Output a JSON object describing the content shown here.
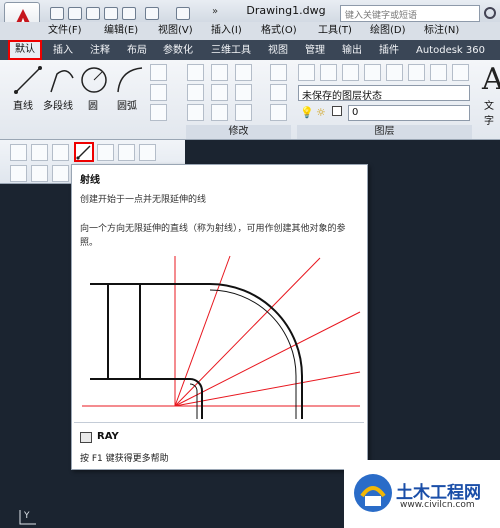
{
  "title_bar": {
    "document_title": "Drawing1.dwg",
    "search_placeholder": "键入关键字或短语",
    "qa_more": "»"
  },
  "menu": [
    "文件(F)",
    "编辑(E)",
    "视图(V)",
    "插入(I)",
    "格式(O)",
    "工具(T)",
    "绘图(D)",
    "标注(N)"
  ],
  "tabs": [
    "默认",
    "插入",
    "注释",
    "布局",
    "参数化",
    "三维工具",
    "视图",
    "管理",
    "输出",
    "插件",
    "Autodesk 360"
  ],
  "ribbon": {
    "draw_tools": [
      "直线",
      "多段线",
      "圆",
      "圆弧"
    ],
    "modify_panel": "修改",
    "layers_panel": "图层",
    "layer_state": "未保存的图层状态",
    "layer_value": "0",
    "text_label": "文字"
  },
  "tooltip": {
    "title": "射线",
    "description": "创建开始于一点并无限延伸的线",
    "body": "向一个方向无限延伸的直线（称为射线），可用作创建其他对象的参照。",
    "command": "RAY",
    "help": "按 F1 键获得更多帮助"
  },
  "watermark": {
    "title": "土木工程网",
    "url": "www.civilcn.com"
  },
  "colors": {
    "ray_red": "#e8171f",
    "highlight": "#e00000",
    "tab_bar": "#3a4656"
  }
}
